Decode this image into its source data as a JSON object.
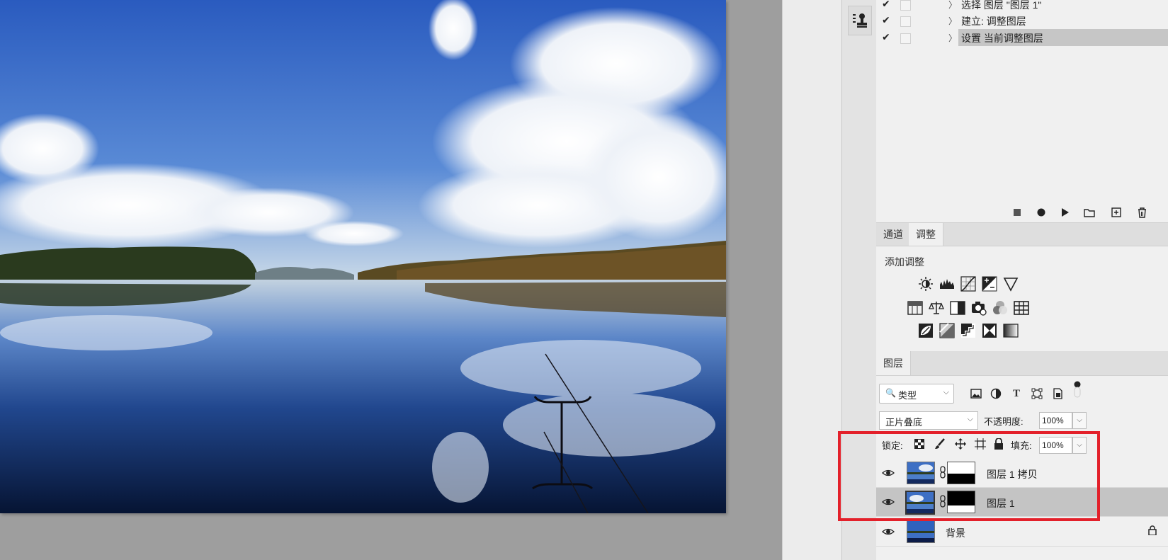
{
  "actions": {
    "rows": [
      {
        "label": "选择 图层 \"图层 1\"",
        "checked": true
      },
      {
        "label": "建立: 调整图层",
        "checked": true
      },
      {
        "label": "设置 当前调整图层",
        "checked": true,
        "selected": true
      }
    ],
    "bar_icons": [
      "stop-icon",
      "record-icon",
      "play-icon",
      "folder-icon",
      "new-action-icon",
      "trash-icon"
    ]
  },
  "adjust_panel": {
    "tabs": [
      "通道",
      "调整"
    ],
    "active_tab": "调整",
    "title": "添加调整",
    "icon_rows": [
      [
        "brightness-contrast-icon",
        "levels-icon",
        "curves-icon",
        "exposure-icon",
        "vibrance-icon"
      ],
      [
        "hue-saturation-icon",
        "color-balance-icon",
        "black-white-icon",
        "photo-filter-icon",
        "channel-mixer-icon",
        "color-lookup-icon"
      ],
      [
        "invert-icon",
        "posterize-icon",
        "threshold-icon",
        "selective-color-icon",
        "gradient-map-icon"
      ]
    ]
  },
  "layers_panel": {
    "tab": "图层",
    "filter": {
      "kind": "类型"
    },
    "blend_mode": "正片叠底",
    "opacity_label": "不透明度:",
    "opacity_value": "100%",
    "lock_label": "锁定:",
    "fill_label": "填充:",
    "fill_value": "100%",
    "layers": [
      {
        "name": "图层 1 拷贝",
        "visible": true,
        "has_mask": true,
        "selected": false
      },
      {
        "name": "图层 1",
        "visible": true,
        "has_mask": true,
        "selected": true
      },
      {
        "name": "背景",
        "visible": true,
        "has_mask": false,
        "locked": true,
        "selected": false
      }
    ]
  },
  "colors": {
    "highlight": "#e3202a",
    "panel_bg": "#f0f0f0",
    "canvas_bg": "#9e9e9e",
    "selected_row": "#c4c4c4"
  }
}
